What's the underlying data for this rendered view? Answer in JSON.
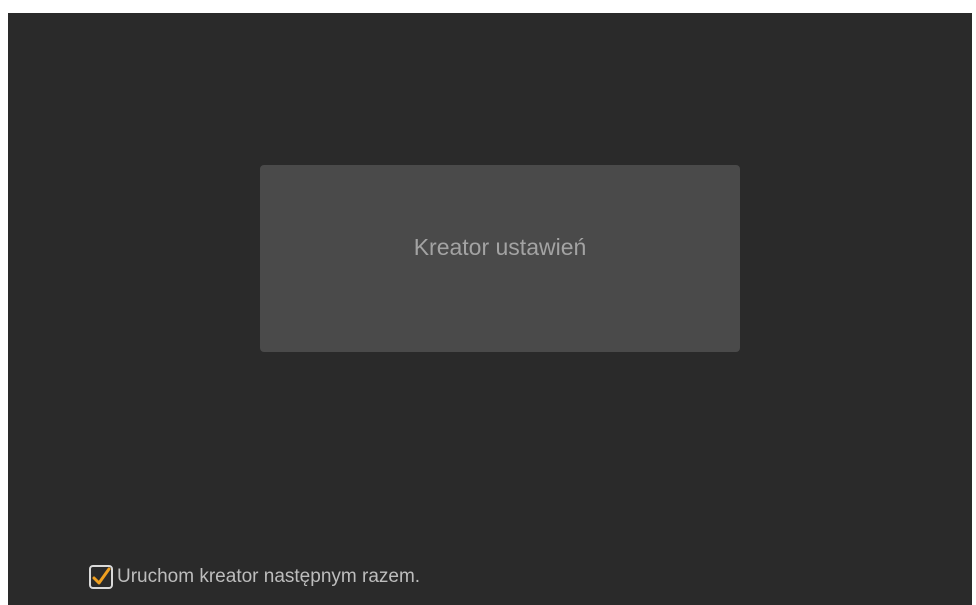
{
  "wizard": {
    "button_label": "Kreator ustawień"
  },
  "startup_option": {
    "checked": true,
    "label": "Uruchom kreator następnym razem.",
    "check_icon": "checkmark-icon"
  },
  "colors": {
    "background": "#2a2a2a",
    "button": "#4a4a4a",
    "button_text": "#a3a3a3",
    "label_text": "#bdbdbd",
    "checkmark_accent": "#f0a020"
  }
}
